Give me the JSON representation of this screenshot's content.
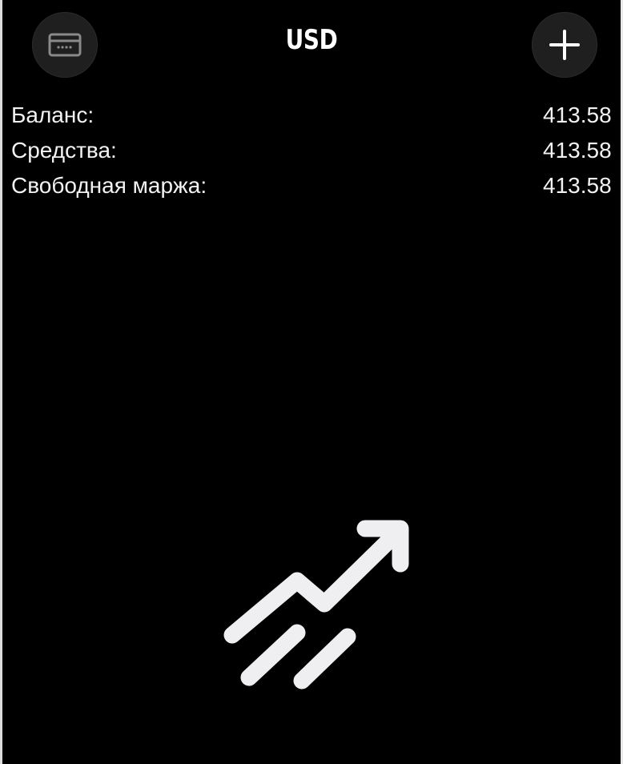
{
  "header": {
    "title": "USD",
    "left_icon": "card-icon",
    "right_icon": "plus-icon"
  },
  "account": {
    "rows": [
      {
        "label": "Баланс:",
        "value": "413.58"
      },
      {
        "label": "Средства:",
        "value": "413.58"
      },
      {
        "label": "Свободная маржа:",
        "value": "413.58"
      }
    ]
  },
  "empty_state": {
    "icon": "trend-up-icon"
  },
  "colors": {
    "background": "#000000",
    "text": "#ffffff",
    "button": "#1f1f1f",
    "icon": "#efeff1"
  }
}
